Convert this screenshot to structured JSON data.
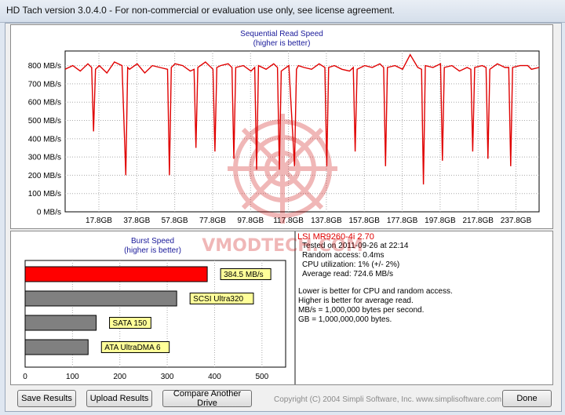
{
  "window": {
    "title": "HD Tach version 3.0.4.0  - For non-commercial or evaluation use only, see license agreement."
  },
  "sequential_chart": {
    "title": "Sequential Read Speed",
    "subtitle": "(higher is better)",
    "y_ticks": [
      "0 MB/s",
      "100 MB/s",
      "200 MB/s",
      "300 MB/s",
      "400 MB/s",
      "500 MB/s",
      "600 MB/s",
      "700 MB/s",
      "800 MB/s"
    ],
    "x_ticks": [
      "17.8GB",
      "37.8GB",
      "57.8GB",
      "77.8GB",
      "97.8GB",
      "117.8GB",
      "137.8GB",
      "157.8GB",
      "177.8GB",
      "197.8GB",
      "217.8GB",
      "237.8GB"
    ]
  },
  "chart_data": [
    {
      "type": "line",
      "title": "Sequential Read Speed",
      "subtitle": "(higher is better)",
      "xlabel": "",
      "ylabel": "",
      "x_unit": "GB",
      "y_unit": "MB/s",
      "xlim": [
        0,
        250
      ],
      "ylim": [
        0,
        880
      ],
      "series": [
        {
          "color": "#e00000",
          "baseline": 790,
          "x": [
            0,
            4,
            8,
            12,
            14,
            15,
            16,
            18,
            22,
            26,
            30,
            32,
            33,
            34,
            38,
            42,
            46,
            50,
            54,
            55,
            56,
            58,
            62,
            66,
            68,
            69,
            70,
            74,
            78,
            79,
            80,
            82,
            86,
            88,
            89,
            90,
            94,
            98,
            100,
            101,
            102,
            106,
            110,
            112,
            113,
            114,
            118,
            121,
            122,
            123,
            126,
            130,
            134,
            137,
            138,
            139,
            142,
            146,
            150,
            152,
            153,
            154,
            158,
            162,
            166,
            168,
            169,
            170,
            174,
            178,
            182,
            186,
            188,
            189,
            190,
            194,
            198,
            199,
            200,
            204,
            208,
            212,
            214,
            215,
            216,
            220,
            222,
            223,
            224,
            228,
            232,
            234,
            235,
            236,
            240,
            244,
            246,
            250
          ],
          "y": [
            780,
            800,
            770,
            810,
            790,
            440,
            780,
            800,
            760,
            820,
            800,
            200,
            790,
            780,
            810,
            760,
            800,
            790,
            780,
            200,
            790,
            810,
            800,
            770,
            780,
            350,
            790,
            820,
            780,
            330,
            790,
            800,
            810,
            790,
            290,
            790,
            800,
            770,
            790,
            230,
            800,
            780,
            810,
            790,
            230,
            770,
            800,
            250,
            780,
            800,
            790,
            780,
            810,
            790,
            250,
            790,
            800,
            780,
            770,
            790,
            330,
            780,
            800,
            790,
            810,
            790,
            250,
            790,
            800,
            780,
            860,
            790,
            780,
            150,
            800,
            790,
            810,
            280,
            790,
            800,
            770,
            790,
            780,
            330,
            790,
            800,
            790,
            290,
            780,
            810,
            790,
            790,
            250,
            790,
            800,
            800,
            780,
            790
          ]
        }
      ]
    },
    {
      "type": "bar",
      "orientation": "horizontal",
      "title": "Burst Speed",
      "subtitle": "(higher is better)",
      "xlim": [
        0,
        550
      ],
      "x_ticks": [
        0,
        100,
        200,
        300,
        400,
        500
      ],
      "categories": [
        "384.5 MB/s",
        "SCSI Ultra320",
        "SATA 150",
        "ATA UltraDMA 6"
      ],
      "values": [
        384.5,
        320,
        150,
        133
      ],
      "colors": [
        "#ff0000",
        "#808080",
        "#808080",
        "#808080"
      ]
    }
  ],
  "info": {
    "drive": "LSI MR9260-4i 2.70",
    "tested": "Tested on 2011-09-26 at 22:14",
    "random_access": "Random access: 0.4ms",
    "cpu": "CPU utilization: 1% (+/- 2%)",
    "avg_read": "Average read: 724.6 MB/s",
    "note1": "Lower is better for CPU and random access.",
    "note2": "Higher is better for average read.",
    "note3": "MB/s = 1,000,000 bytes per second.",
    "note4": "GB = 1,000,000,000 bytes."
  },
  "buttons": {
    "save": "Save Results",
    "upload": "Upload Results",
    "compare": "Compare Another Drive",
    "done": "Done"
  },
  "copyright": "Copyright (C) 2004 Simpli Software, Inc. www.simplisoftware.com",
  "watermark_text": "VMODTECH.COM"
}
